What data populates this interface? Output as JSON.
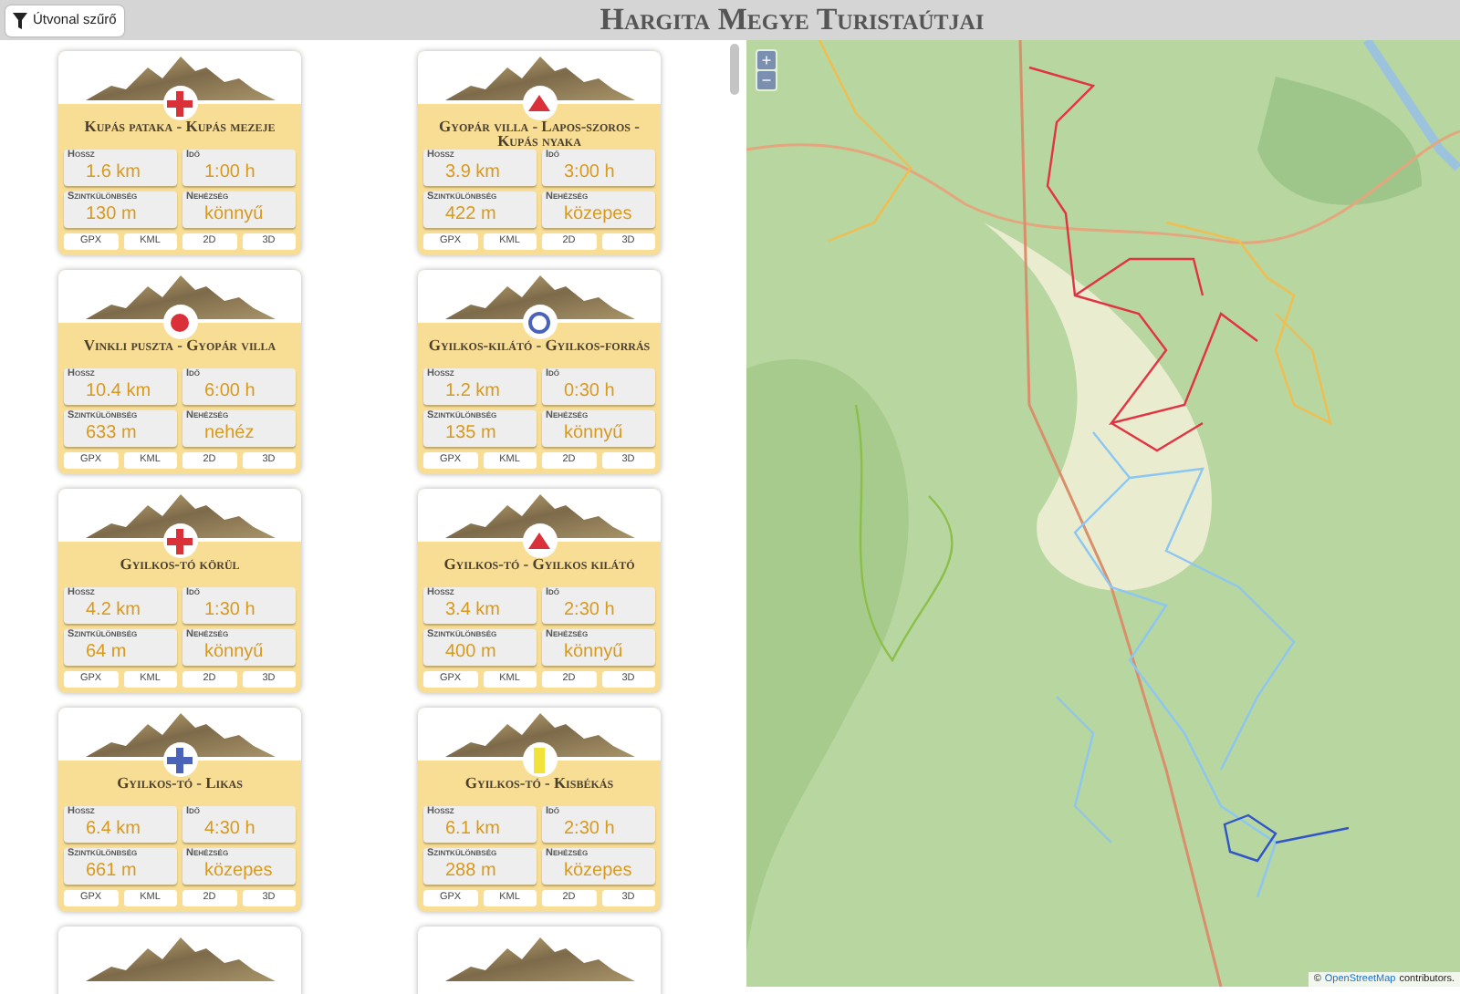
{
  "header": {
    "filter_button": "Útvonal szűrő",
    "title": "Hargita Megye Turistaútjai"
  },
  "cards": [
    {
      "kind": "full",
      "marker": {
        "kind": "cross",
        "color": "#d9303a"
      },
      "title": "Kupás pataka - Kupás mezeje",
      "stats": [
        {
          "label": "Hossz",
          "value": "1.6 km"
        },
        {
          "label": "Idő",
          "value": "1:00 h"
        },
        {
          "label": "Szintkülönbség",
          "value": "130 m"
        },
        {
          "label": "Nehézség",
          "value": "könnyű"
        }
      ],
      "downloads": [
        "GPX",
        "KML",
        "2D",
        "3D"
      ]
    },
    {
      "kind": "full",
      "marker": {
        "kind": "triangle",
        "color": "#d9303a"
      },
      "title": "Gyopár villa - Lapos-szoros - Kupás nyaka",
      "stats": [
        {
          "label": "Hossz",
          "value": "3.9 km"
        },
        {
          "label": "Idő",
          "value": "3:00 h"
        },
        {
          "label": "Szintkülönbség",
          "value": "422 m"
        },
        {
          "label": "Nehézség",
          "value": "közepes"
        }
      ],
      "downloads": [
        "GPX",
        "KML",
        "2D",
        "3D"
      ]
    },
    {
      "kind": "full",
      "marker": {
        "kind": "dot",
        "color": "#d9303a"
      },
      "title": "Vinkli puszta - Gyopár villa",
      "stats": [
        {
          "label": "Hossz",
          "value": "10.4 km"
        },
        {
          "label": "Idő",
          "value": "6:00 h"
        },
        {
          "label": "Szintkülönbség",
          "value": "633 m"
        },
        {
          "label": "Nehézség",
          "value": "nehéz"
        }
      ],
      "downloads": [
        "GPX",
        "KML",
        "2D",
        "3D"
      ]
    },
    {
      "kind": "full",
      "marker": {
        "kind": "ring",
        "color": "#4a63b8"
      },
      "title": "Gyilkos-kilátó - Gyilkos-forrás",
      "stats": [
        {
          "label": "Hossz",
          "value": "1.2 km"
        },
        {
          "label": "Idő",
          "value": "0:30 h"
        },
        {
          "label": "Szintkülönbség",
          "value": "135 m"
        },
        {
          "label": "Nehézség",
          "value": "könnyű"
        }
      ],
      "downloads": [
        "GPX",
        "KML",
        "2D",
        "3D"
      ]
    },
    {
      "kind": "full",
      "marker": {
        "kind": "cross",
        "color": "#d9303a"
      },
      "title": "Gyilkos-tó körül",
      "stats": [
        {
          "label": "Hossz",
          "value": "4.2 km"
        },
        {
          "label": "Idő",
          "value": "1:30 h"
        },
        {
          "label": "Szintkülönbség",
          "value": "64 m"
        },
        {
          "label": "Nehézség",
          "value": "könnyű"
        }
      ],
      "downloads": [
        "GPX",
        "KML",
        "2D",
        "3D"
      ]
    },
    {
      "kind": "full",
      "marker": {
        "kind": "triangle",
        "color": "#d9303a"
      },
      "title": "Gyilkos-tó - Gyilkos kilátó",
      "stats": [
        {
          "label": "Hossz",
          "value": "3.4 km"
        },
        {
          "label": "Idő",
          "value": "2:30 h"
        },
        {
          "label": "Szintkülönbség",
          "value": "400 m"
        },
        {
          "label": "Nehézség",
          "value": "könnyű"
        }
      ],
      "downloads": [
        "GPX",
        "KML",
        "2D",
        "3D"
      ]
    },
    {
      "kind": "full",
      "marker": {
        "kind": "cross",
        "color": "#4a63b8"
      },
      "title": "Gyilkos-tó - Likas",
      "stats": [
        {
          "label": "Hossz",
          "value": "6.4 km"
        },
        {
          "label": "Idő",
          "value": "4:30 h"
        },
        {
          "label": "Szintkülönbség",
          "value": "661 m"
        },
        {
          "label": "Nehézség",
          "value": "közepes"
        }
      ],
      "downloads": [
        "GPX",
        "KML",
        "2D",
        "3D"
      ]
    },
    {
      "kind": "full",
      "marker": {
        "kind": "bar",
        "color": "#f2e33a"
      },
      "title": "Gyilkos-tó - Kisbékás",
      "stats": [
        {
          "label": "Hossz",
          "value": "6.1 km"
        },
        {
          "label": "Idő",
          "value": "2:30 h"
        },
        {
          "label": "Szintkülönbség",
          "value": "288 m"
        },
        {
          "label": "Nehézség",
          "value": "közepes"
        }
      ],
      "downloads": [
        "GPX",
        "KML",
        "2D",
        "3D"
      ]
    },
    {
      "kind": "partial"
    },
    {
      "kind": "partial"
    }
  ],
  "map": {
    "zoom_in": "+",
    "zoom_out": "−",
    "attribution_prefix": "©",
    "attribution_link": "OpenStreetMap",
    "attribution_suffix": "contributors."
  }
}
